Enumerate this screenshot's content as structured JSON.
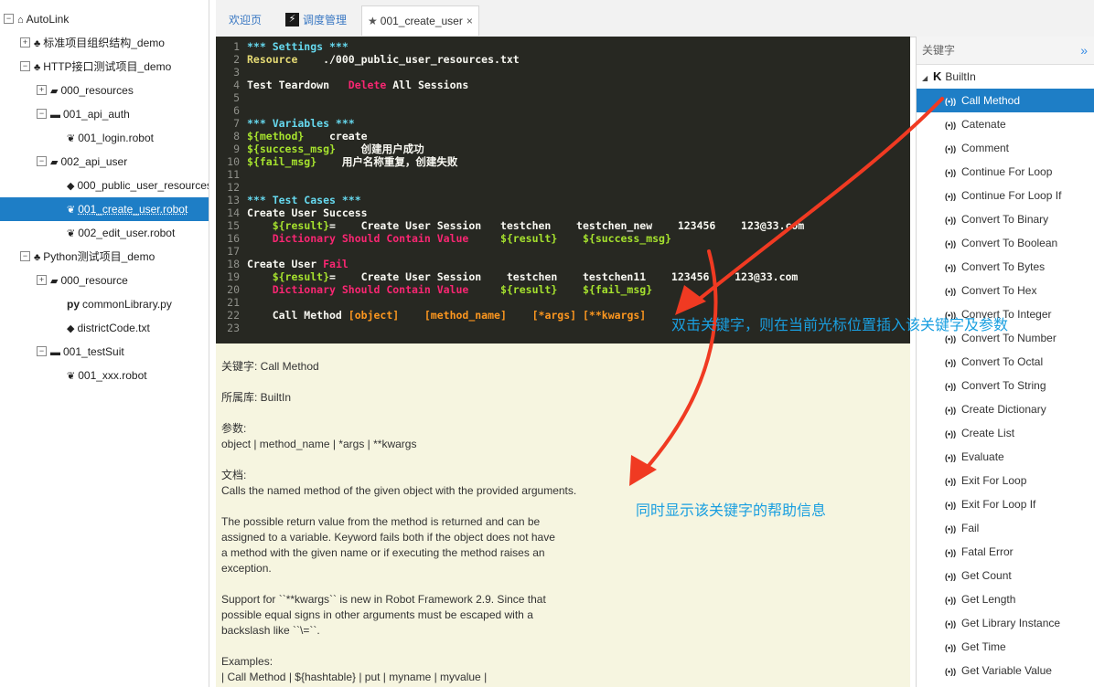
{
  "tree": {
    "items": [
      {
        "label": "AutoLink",
        "icon": "home-icon",
        "expander": "−",
        "level": 0
      },
      {
        "label": "标准项目组织结构_demo",
        "icon": "tree-icon",
        "expander": "+",
        "level": 1
      },
      {
        "label": "HTTP接口测试项目_demo",
        "icon": "tree-icon",
        "expander": "−",
        "level": 1
      },
      {
        "label": "000_resources",
        "icon": "folder-open-icon",
        "expander": "+",
        "level": 2
      },
      {
        "label": "001_api_auth",
        "icon": "folder-icon",
        "expander": "−",
        "level": 2
      },
      {
        "label": "001_login.robot",
        "icon": "leaf-icon",
        "expander": "",
        "level": 3
      },
      {
        "label": "002_api_user",
        "icon": "folder-open-icon",
        "expander": "−",
        "level": 2
      },
      {
        "label": "000_public_user_resources.txt",
        "icon": "cube-icon",
        "expander": "",
        "level": 3
      },
      {
        "label": "001_create_user.robot",
        "icon": "leaf-icon",
        "expander": "",
        "level": 3,
        "selected": true
      },
      {
        "label": "002_edit_user.robot",
        "icon": "leaf-icon",
        "expander": "",
        "level": 3
      },
      {
        "label": "Python测试项目_demo",
        "icon": "tree-icon",
        "expander": "−",
        "level": 1
      },
      {
        "label": "000_resource",
        "icon": "folder-open-icon",
        "expander": "+",
        "level": 2
      },
      {
        "label": "commonLibrary.py",
        "icon": "python-icon",
        "expander": "",
        "level": 3
      },
      {
        "label": "districtCode.txt",
        "icon": "cube-icon",
        "expander": "",
        "level": 3
      },
      {
        "label": "001_testSuit",
        "icon": "folder-icon",
        "expander": "−",
        "level": 2
      },
      {
        "label": "001_xxx.robot",
        "icon": "leaf-icon",
        "expander": "",
        "level": 3
      }
    ]
  },
  "tabs": [
    {
      "label": "欢迎页",
      "icon": ""
    },
    {
      "label": "调度管理",
      "icon": "flag-icon"
    },
    {
      "label": "001_create_user",
      "icon": "star-icon",
      "close": "×"
    }
  ],
  "editor": {
    "lines": [
      [
        {
          "t": "*** Settings ***",
          "c": "blue"
        }
      ],
      [
        {
          "t": "Resource",
          "c": "yellow"
        },
        {
          "t": "    ./000_public_user_resources.txt",
          "c": "white"
        }
      ],
      [],
      [
        {
          "t": "Test Teardown   ",
          "c": "white"
        },
        {
          "t": "Delete",
          "c": "pink"
        },
        {
          "t": " All Sessions",
          "c": "white"
        }
      ],
      [],
      [],
      [
        {
          "t": "*** Variables ***",
          "c": "blue"
        }
      ],
      [
        {
          "t": "${method}",
          "c": "green"
        },
        {
          "t": "    create",
          "c": "white"
        }
      ],
      [
        {
          "t": "${success_msg}",
          "c": "green"
        },
        {
          "t": "    创建用户成功",
          "c": "white"
        }
      ],
      [
        {
          "t": "${fail_msg}",
          "c": "green"
        },
        {
          "t": "    用户名称重复，创建失败",
          "c": "white"
        }
      ],
      [],
      [],
      [
        {
          "t": "*** Test Cases ***",
          "c": "blue"
        }
      ],
      [
        {
          "t": "Create User Success",
          "c": "white"
        }
      ],
      [
        {
          "t": "    ",
          "c": "white"
        },
        {
          "t": "${result}",
          "c": "green"
        },
        {
          "t": "=    Create User Session   testchen    testchen_new    123456    123@33.com",
          "c": "white"
        }
      ],
      [
        {
          "t": "    Dictionary Should Contain Value",
          "c": "pink"
        },
        {
          "t": "     ",
          "c": "white"
        },
        {
          "t": "${result}",
          "c": "green"
        },
        {
          "t": "    ",
          "c": "white"
        },
        {
          "t": "${success_msg}",
          "c": "green"
        }
      ],
      [],
      [
        {
          "t": "Create User ",
          "c": "white"
        },
        {
          "t": "Fail",
          "c": "pink"
        }
      ],
      [
        {
          "t": "    ",
          "c": "white"
        },
        {
          "t": "${result}",
          "c": "green"
        },
        {
          "t": "=    Create User Session    testchen    testchen11    123456    123@33.com",
          "c": "white"
        }
      ],
      [
        {
          "t": "    Dictionary Should Contain Value",
          "c": "pink"
        },
        {
          "t": "     ",
          "c": "white"
        },
        {
          "t": "${result}",
          "c": "green"
        },
        {
          "t": "    ",
          "c": "white"
        },
        {
          "t": "${fail_msg}",
          "c": "green"
        }
      ],
      [],
      [
        {
          "t": "    Call Method ",
          "c": "white"
        },
        {
          "t": "[object]",
          "c": "orange"
        },
        {
          "t": "    ",
          "c": "white"
        },
        {
          "t": "[method_name]",
          "c": "orange"
        },
        {
          "t": "    ",
          "c": "white"
        },
        {
          "t": "[*args]",
          "c": "orange"
        },
        {
          "t": " ",
          "c": "white"
        },
        {
          "t": "[**kwargs]",
          "c": "orange"
        }
      ],
      []
    ]
  },
  "doc": {
    "lines": [
      "关键字: Call Method",
      "",
      "所属库: BuiltIn",
      "",
      "参数:",
      "object | method_name | *args | **kwargs",
      "",
      "文档:",
      "Calls the named method of the given object with the provided arguments.",
      "",
      "The possible return value from the method is returned and can be",
      "assigned to a variable. Keyword fails both if the object does not have",
      "a method with the given name or if executing the method raises an",
      "exception.",
      "",
      "Support for ``**kwargs`` is new in Robot Framework 2.9. Since that",
      "possible equal signs in other arguments must be escaped with a",
      "backslash like ``\\=``.",
      "",
      "Examples:",
      "| Call Method | ${hashtable} | put | myname | myvalue |"
    ]
  },
  "keywords": {
    "header": "关键字",
    "collapse_icon": "»",
    "library": {
      "label": "BuiltIn",
      "icon": "k-logo-icon",
      "expander": "◢"
    },
    "broadcast_glyph": "(•))",
    "items": [
      {
        "label": "Call Method",
        "selected": true
      },
      {
        "label": "Catenate"
      },
      {
        "label": "Comment"
      },
      {
        "label": "Continue For Loop"
      },
      {
        "label": "Continue For Loop If"
      },
      {
        "label": "Convert To Binary"
      },
      {
        "label": "Convert To Boolean"
      },
      {
        "label": "Convert To Bytes"
      },
      {
        "label": "Convert To Hex"
      },
      {
        "label": "Convert To Integer"
      },
      {
        "label": "Convert To Number"
      },
      {
        "label": "Convert To Octal"
      },
      {
        "label": "Convert To String"
      },
      {
        "label": "Create Dictionary"
      },
      {
        "label": "Create List"
      },
      {
        "label": "Evaluate"
      },
      {
        "label": "Exit For Loop"
      },
      {
        "label": "Exit For Loop If"
      },
      {
        "label": "Fail"
      },
      {
        "label": "Fatal Error"
      },
      {
        "label": "Get Count"
      },
      {
        "label": "Get Length"
      },
      {
        "label": "Get Library Instance"
      },
      {
        "label": "Get Time"
      },
      {
        "label": "Get Variable Value"
      }
    ]
  },
  "annotations": {
    "insert_hint": "双击关键字，则在当前光标位置插入该关键字及参数",
    "help_hint": "同时显示该关键字的帮助信息",
    "arrow_color": "#f03a22",
    "text_color": "#1a9fe0"
  }
}
